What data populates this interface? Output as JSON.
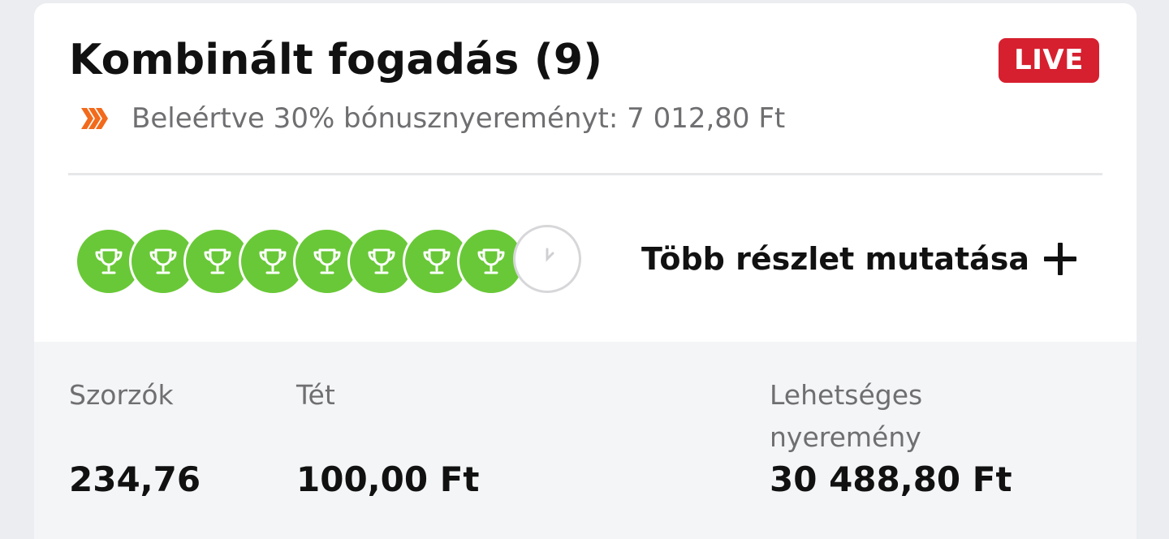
{
  "bet": {
    "title": "Kombinált fogadás (9)",
    "live_badge": "LIVE",
    "bonus_text": "Beleértve 30% bónusznyereményt: 7 012,80 Ft",
    "legs": [
      "won",
      "won",
      "won",
      "won",
      "won",
      "won",
      "won",
      "won",
      "pending"
    ],
    "more_details_label": "Több részlet mutatása"
  },
  "summary": {
    "odds_label": "Szorzók",
    "odds_value": "234,76",
    "stake_label": "Tét",
    "stake_value": "100,00 Ft",
    "potential_win_label": "Lehetséges nyeremény",
    "potential_win_value": "30 488,80 Ft"
  },
  "colors": {
    "live_badge": "#d6202f",
    "won_leg": "#69c837",
    "bonus_icon": "#f26a1b"
  },
  "icons": {
    "bonus": "double-chevron-icon",
    "won_leg": "trophy-icon",
    "pending_leg": "clock-icon",
    "expand": "plus-icon"
  }
}
